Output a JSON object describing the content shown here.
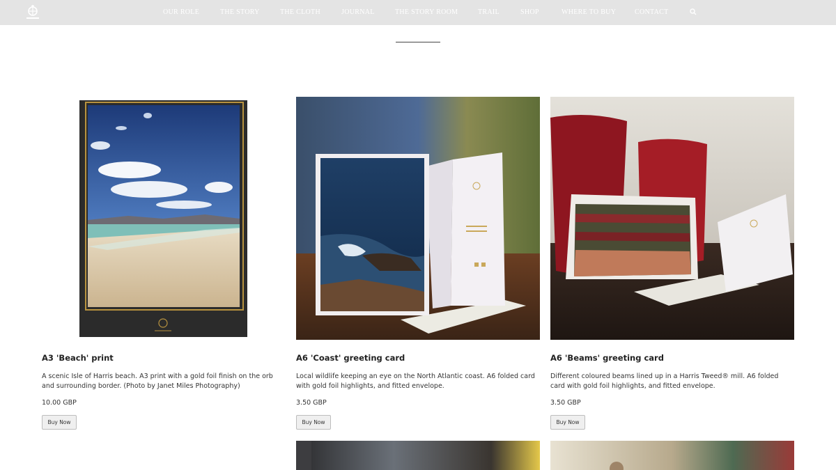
{
  "nav": {
    "items": [
      "OUR ROLE",
      "THE STORY",
      "THE CLOTH",
      "JOURNAL",
      "THE STORY ROOM",
      "TRAIL",
      "SHOP",
      "WHERE TO BUY",
      "CONTACT"
    ],
    "search_icon": "search-icon",
    "logo_icon": "orb-logo-icon"
  },
  "products": [
    {
      "title": "A3 'Beach' print",
      "description": "A scenic Isle of Harris beach. A3 print with a gold foil finish on the orb and surrounding border. (Photo by Janet Miles Photography)",
      "price": "10.00 GBP",
      "button": "Buy Now"
    },
    {
      "title": "A6 'Coast' greeting card",
      "description": "Local wildlife keeping an eye on the North Atlantic coast. A6 folded card with gold foil highlights, and fitted envelope.",
      "price": "3.50 GBP",
      "button": "Buy Now"
    },
    {
      "title": "A6 'Beams' greeting card",
      "description": "Different coloured beams lined up in a Harris Tweed® mill. A6 folded card with gold foil highlights, and fitted envelope.",
      "price": "3.50 GBP",
      "button": "Buy Now"
    }
  ],
  "colors": {
    "header_bg": "#e4e4e4",
    "gold": "#b8933f"
  }
}
